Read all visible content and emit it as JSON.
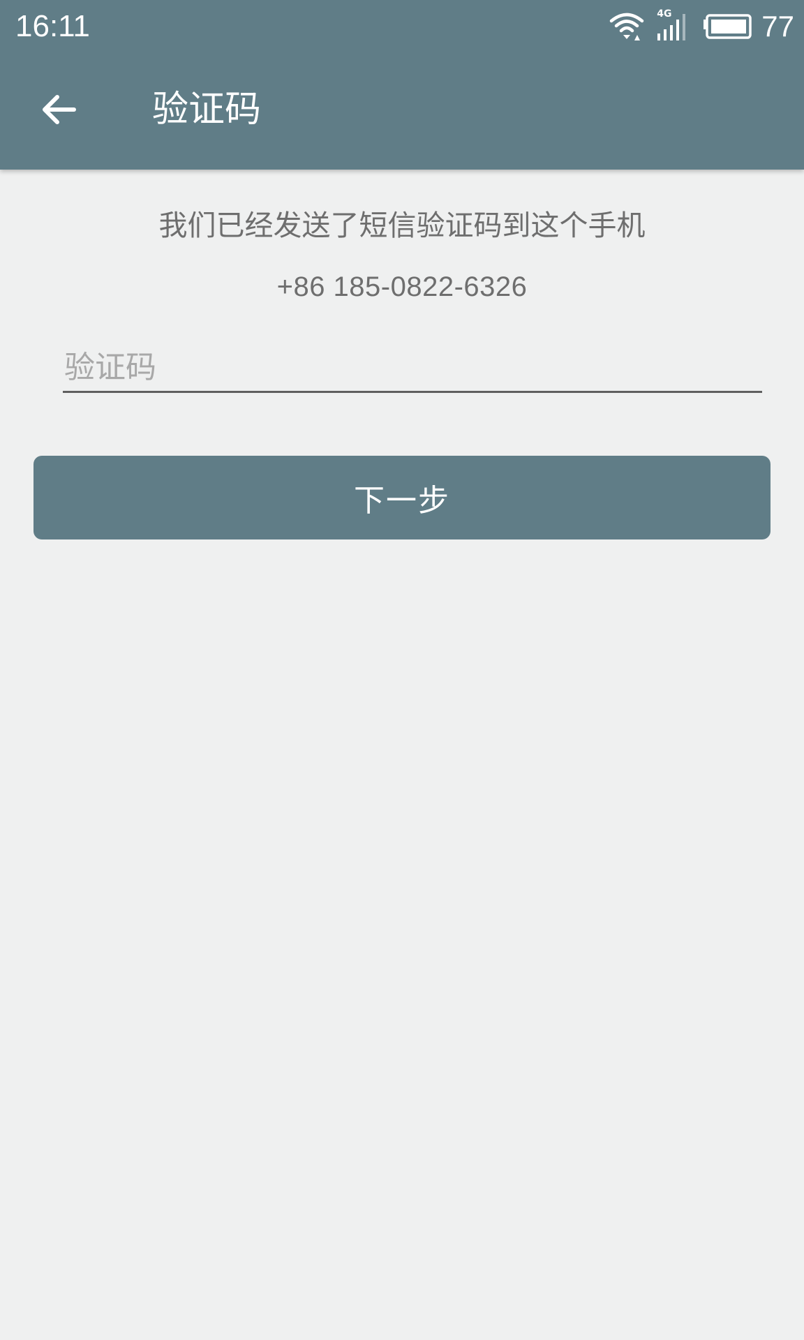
{
  "status_bar": {
    "time": "16:11",
    "network_type": "4G",
    "battery_level": "77",
    "icons": [
      "wifi-icon",
      "signal-icon",
      "battery-icon"
    ]
  },
  "toolbar": {
    "back_icon": "arrow-left-icon",
    "title": "验证码"
  },
  "main": {
    "hint": "我们已经发送了短信验证码到这个手机",
    "phone_number": "+86 185-0822-6326",
    "code_input": {
      "placeholder": "验证码",
      "value": ""
    },
    "next_button_label": "下一步"
  },
  "colors": {
    "primary": "#607d87",
    "background": "#eff0f0",
    "text_secondary": "#6e6e6e",
    "placeholder": "#a8a8a8"
  }
}
